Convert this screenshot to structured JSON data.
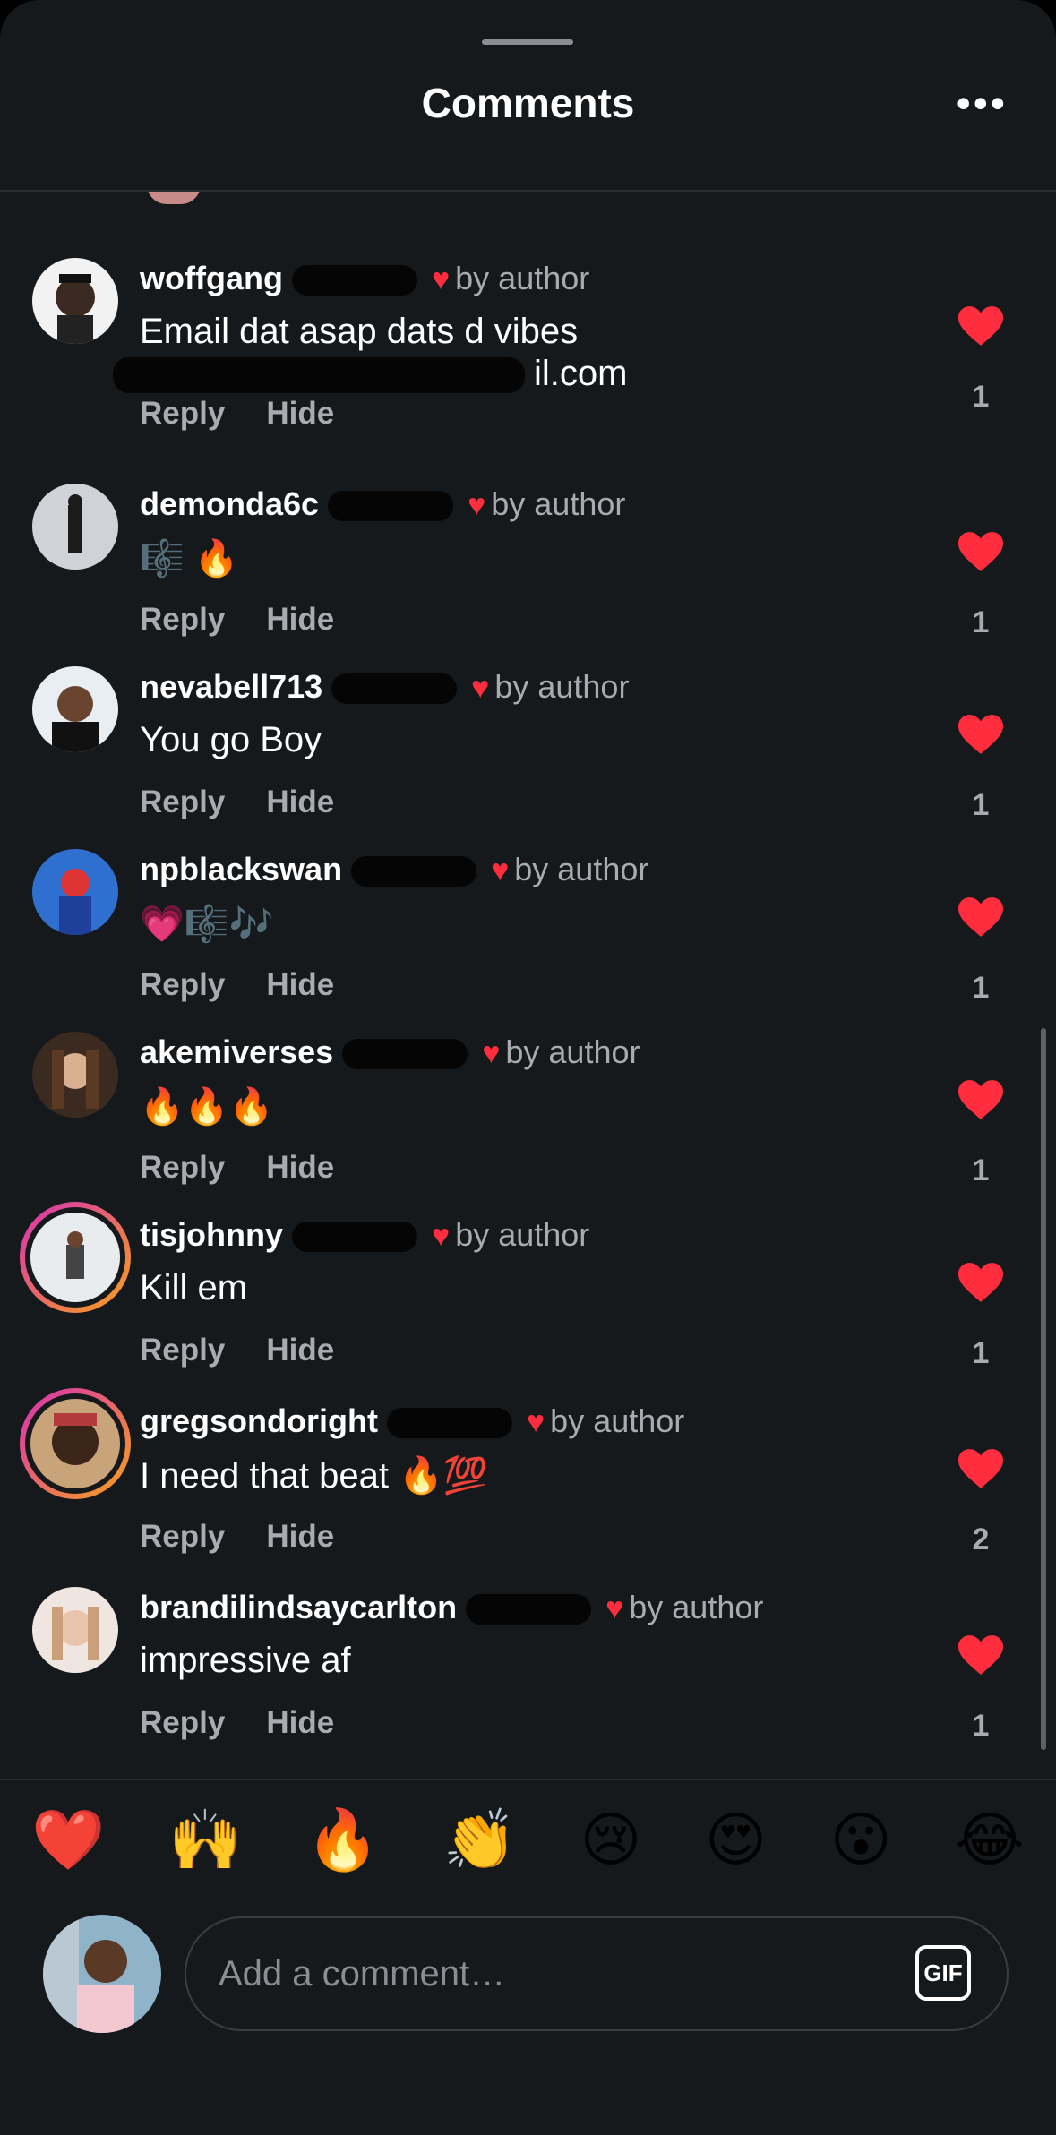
{
  "header": {
    "title": "Comments",
    "more_icon": "ellipsis-icon"
  },
  "labels": {
    "by_author": "by author",
    "reply": "Reply",
    "hide": "Hide"
  },
  "comments": [
    {
      "username": "woffgang",
      "text": "Email dat asap dats d vibes",
      "text2": "il.com",
      "likes": "1"
    },
    {
      "username": "demonda6c",
      "text": "🎼 🔥",
      "likes": "1"
    },
    {
      "username": "nevabell713",
      "text": "You go Boy",
      "likes": "1"
    },
    {
      "username": "npblackswan",
      "text": "💗🎼🎶",
      "likes": "1"
    },
    {
      "username": "akemiverses",
      "text": "🔥🔥🔥",
      "likes": "1"
    },
    {
      "username": "tisjohnny",
      "text": "Kill em",
      "likes": "1"
    },
    {
      "username": "gregsondoright",
      "text": "I need that beat 🔥💯",
      "likes": "2"
    },
    {
      "username": "brandilindsaycarlton",
      "text": "impressive af",
      "likes": "1"
    }
  ],
  "reactions": [
    "❤️",
    "🙌",
    "🔥",
    "👏",
    "😢",
    "😍",
    "😮",
    "😂"
  ],
  "composer": {
    "placeholder": "Add a comment…",
    "gif_label": "GIF"
  },
  "colors": {
    "background": "#16191c",
    "heart": "#ff2d3e",
    "muted": "#a8abaf"
  }
}
